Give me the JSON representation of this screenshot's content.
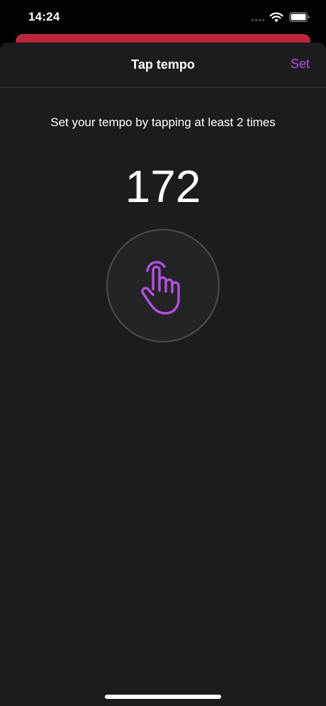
{
  "status_bar": {
    "time": "14:24",
    "wifi_icon": "wifi-icon",
    "battery_icon": "battery-icon"
  },
  "sheet": {
    "title": "Tap tempo",
    "set_label": "Set"
  },
  "main": {
    "instruction": "Set your tempo by tapping at least 2 times",
    "bpm": "172",
    "tap_icon": "tap-hand-icon"
  },
  "colors": {
    "accent": "#b44fe0",
    "background": "#1c1c1e",
    "header_strip": "#b9263b"
  }
}
